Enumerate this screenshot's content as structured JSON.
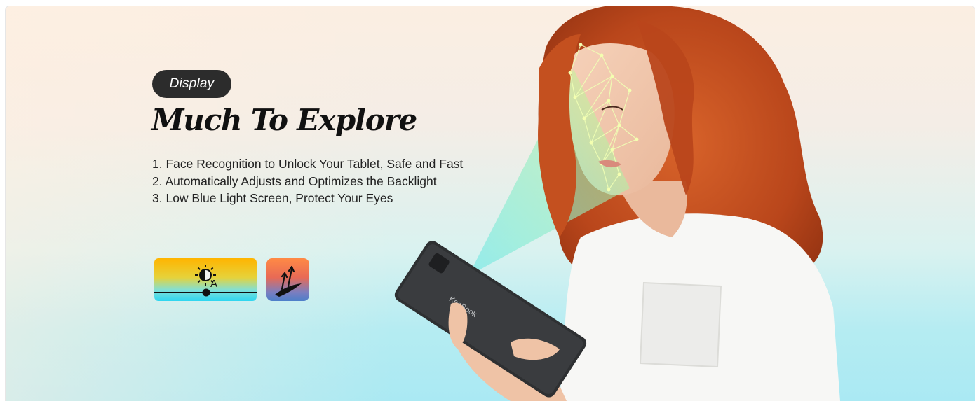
{
  "banner": {
    "badge_label": "Display",
    "headline": "Much To Explore",
    "features": [
      "1. Face Recognition to Unlock Your Tablet, Safe and Fast",
      "2. Automatically Adjusts and Optimizes the Backlight",
      "3. Low Blue Light Screen, Protect Your Eyes"
    ],
    "icons": {
      "brightness": "auto-brightness-icon",
      "boost": "performance-boost-icon"
    },
    "photo": {
      "subject": "woman-holding-tablet",
      "tablet_logo": "KenBook",
      "colors": {
        "hair": "#c8541e",
        "shirt": "#f7f7f5",
        "skin": "#f1c6aa",
        "tablet": "#2e3032",
        "scan_beam": "#7ff0e6",
        "face_mesh": "#e8ff8a"
      }
    }
  }
}
